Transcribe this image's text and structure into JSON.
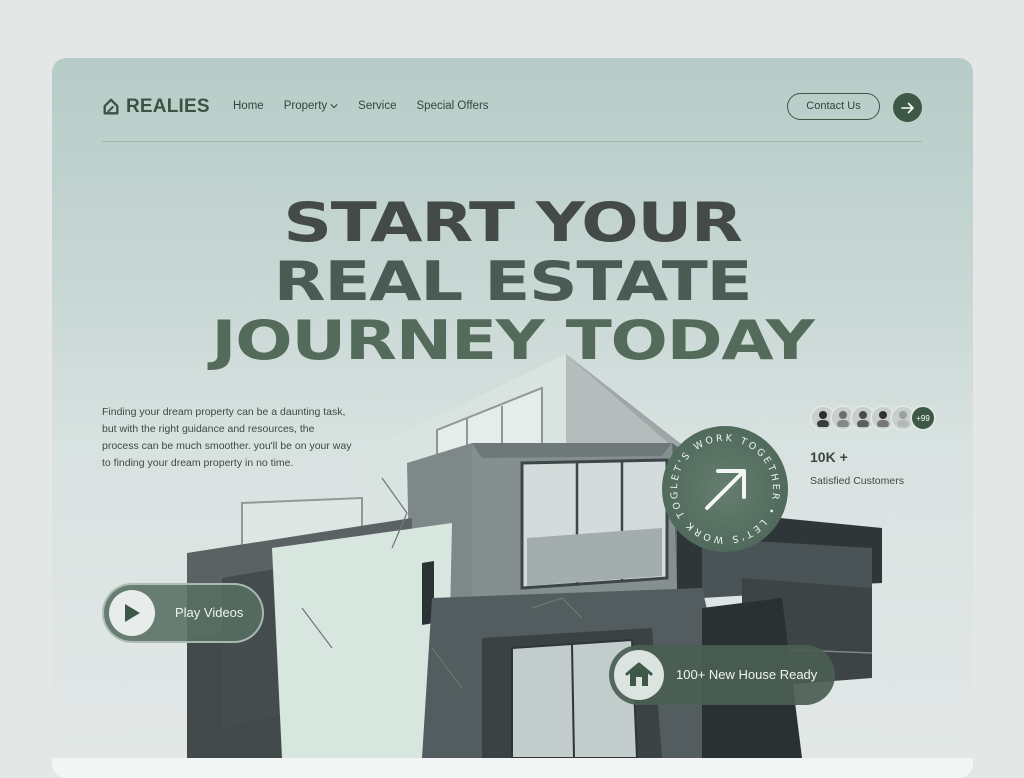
{
  "brand": {
    "name": "REALIES",
    "icon": "leaf-logo-icon"
  },
  "nav": {
    "items": [
      {
        "label": "Home"
      },
      {
        "label": "Property",
        "icon": "chevron-down-icon"
      },
      {
        "label": "Service"
      },
      {
        "label": "Special Offers"
      }
    ],
    "contact_label": "Contact Us",
    "arrow_icon": "arrow-right-icon"
  },
  "hero": {
    "headline": [
      "START YOUR",
      "REAL ESTATE",
      "JOURNEY TODAY"
    ],
    "description": "Finding your dream property can be a daunting task, but with the right guidance and resources, the process can be much smoother. you'll be on your way to finding your dream property in no time."
  },
  "customers": {
    "more_label": "+99",
    "count": "10K +",
    "label": "Satisfied Customers"
  },
  "badge": {
    "circular_text": "LET'S WORK TOGETHER • LET'S WORK TOGETHER •",
    "icon": "arrow-up-right-icon"
  },
  "play": {
    "label": "Play Videos",
    "icon": "play-icon"
  },
  "house": {
    "label": "100+ New House Ready",
    "icon": "house-icon"
  },
  "colors": {
    "accent": "#3e5847",
    "text_dark": "#434a47",
    "background": "#c6d6d3"
  }
}
